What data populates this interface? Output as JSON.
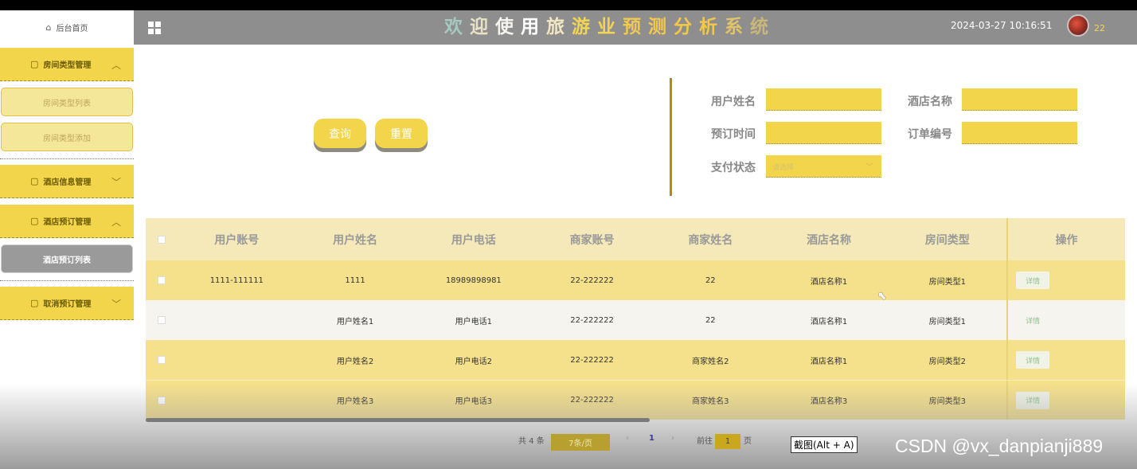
{
  "header": {
    "title_chars": [
      "欢",
      "迎",
      "使",
      "用",
      "旅",
      "游",
      "业",
      "预",
      "测",
      "分",
      "析",
      "系",
      "统"
    ],
    "datetime": "2024-03-27 10:16:51",
    "user": "22",
    "accent": "#f2d54a"
  },
  "sidebar": {
    "home": "后台首页",
    "groups": [
      {
        "label": "房间类型管理",
        "chevron": "^",
        "items": [
          "房间类型列表",
          "房间类型添加"
        ]
      },
      {
        "label": "酒店信息管理",
        "chevron": "v"
      },
      {
        "label": "酒店预订管理",
        "chevron": "^",
        "items": [
          "酒店预订列表"
        ]
      },
      {
        "label": "取消预订管理",
        "chevron": "v"
      }
    ]
  },
  "filters": {
    "query_btn": "查询",
    "reset_btn": "重置",
    "user_name_label": "用户姓名",
    "hotel_name_label": "酒店名称",
    "book_time_label": "预订时间",
    "order_no_label": "订单编号",
    "pay_status_label": "支付状态",
    "pay_status_placeholder": "请选择"
  },
  "table": {
    "headers": [
      "用户账号",
      "用户姓名",
      "用户电话",
      "商家账号",
      "商家姓名",
      "酒店名称",
      "房间类型",
      "操作"
    ],
    "detail_label": "详情",
    "rows": [
      [
        "1111-111111",
        "1111",
        "18989898981",
        "22-222222",
        "22",
        "酒店名称1",
        "房间类型1"
      ],
      [
        "",
        "用户姓名1",
        "用户电话1",
        "22-222222",
        "22",
        "酒店名称1",
        "房间类型1"
      ],
      [
        "",
        "用户姓名2",
        "用户电话2",
        "22-222222",
        "商家姓名2",
        "酒店名称1",
        "房间类型2"
      ],
      [
        "",
        "用户姓名3",
        "用户电话3",
        "22-222222",
        "商家姓名3",
        "酒店名称3",
        "房间类型3"
      ]
    ]
  },
  "pagination": {
    "total": "共 4 条",
    "page_size": "7条/页",
    "prev": "‹",
    "current": "1",
    "next": "›",
    "goto_label": "前往",
    "goto_value": "1",
    "page_suffix": "页"
  },
  "overlay": {
    "snip_tooltip": "截图(Alt + A)",
    "watermark": "CSDN @vx_danpianji889"
  }
}
